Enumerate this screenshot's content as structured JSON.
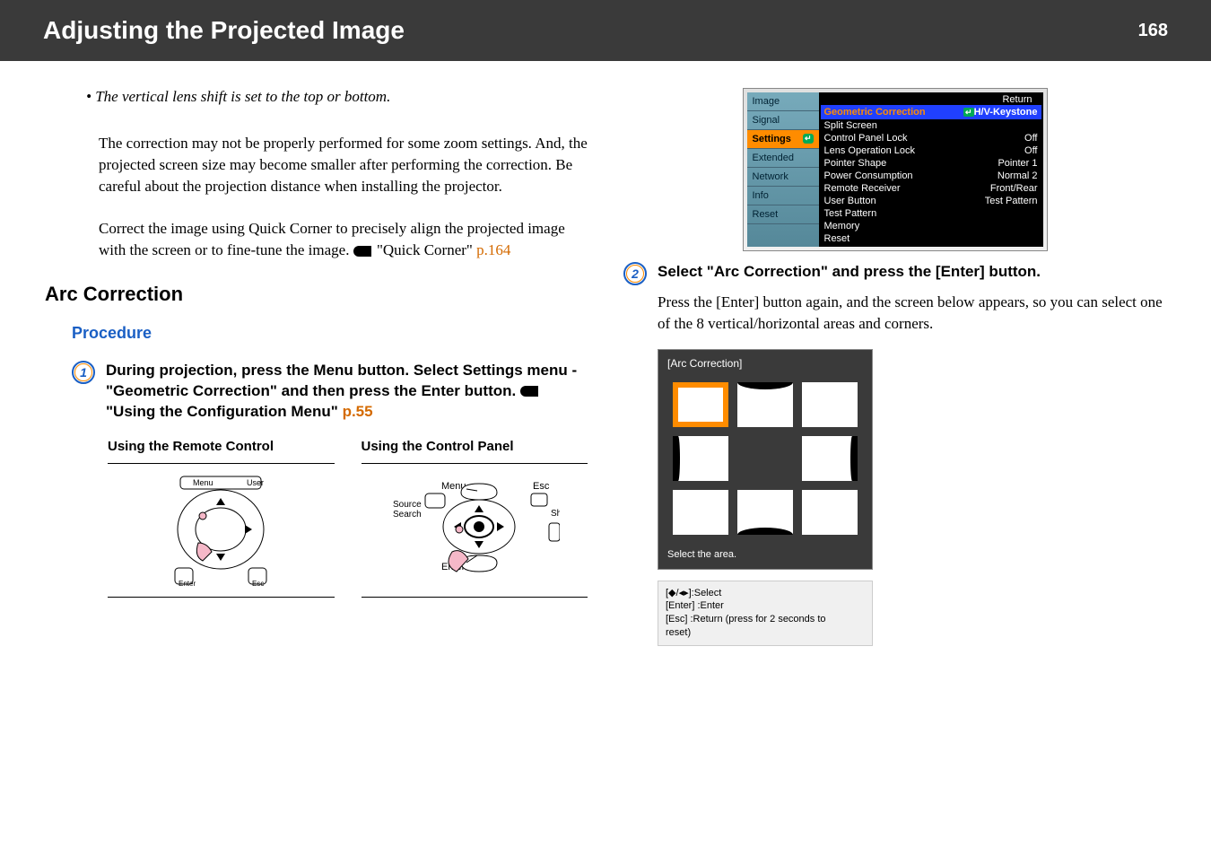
{
  "header": {
    "title": "Adjusting the Projected Image",
    "page": "168"
  },
  "left": {
    "bullet": "The vertical lens shift is set to the top or bottom.",
    "para1": "The correction may not be properly performed for some zoom settings. And, the projected screen size may become smaller after performing the correction. Be careful about the projection distance when installing the projector.",
    "para2_pre": "Correct the image using Quick Corner to precisely align the projected image with the screen or to fine-tune the image. ",
    "para2_link_label": "\"Quick Corner\"",
    "para2_link_page": "p.164",
    "section": "Arc Correction",
    "procedure": "Procedure",
    "step1_num": "1",
    "step1_a": "During projection, press the Menu button. Select Settings menu - \"Geometric Correction\" and then press the Enter button. ",
    "step1_b": "\"Using the Configuration Menu\"",
    "step1_c": "p.55",
    "remote_h": "Using the Remote Control",
    "panel_h": "Using the Control Panel",
    "remote_labels": {
      "menu": "Menu",
      "user": "User",
      "enter": "Enter",
      "esc": "Esc"
    },
    "panel_labels": {
      "menu": "Menu",
      "source": "Source\nSearch",
      "enter": "Enter",
      "esc": "Esc",
      "sh": "Sh"
    }
  },
  "right": {
    "osd": {
      "return": "Return",
      "tabs": [
        "Image",
        "Signal",
        "Settings",
        "Extended",
        "Network",
        "Info",
        "Reset"
      ],
      "selected_tab": "Settings",
      "rows": [
        {
          "k": "Geometric Correction",
          "v": "H/V-Keystone",
          "hl": true,
          "icon": true
        },
        {
          "k": "Split Screen",
          "v": ""
        },
        {
          "k": "Control Panel Lock",
          "v": "Off"
        },
        {
          "k": "Lens Operation Lock",
          "v": "Off"
        },
        {
          "k": "Pointer Shape",
          "v": "Pointer 1"
        },
        {
          "k": "Power Consumption",
          "v": "Normal 2"
        },
        {
          "k": "Remote Receiver",
          "v": "Front/Rear"
        },
        {
          "k": "User Button",
          "v": "Test Pattern"
        },
        {
          "k": "Test Pattern",
          "v": ""
        },
        {
          "k": "Memory",
          "v": ""
        },
        {
          "k": "Reset",
          "v": ""
        }
      ]
    },
    "step2_num": "2",
    "step2_head": "Select \"Arc Correction\" and press the [Enter] button.",
    "step2_body": "Press the [Enter] button again, and the screen below appears, so you can select one of the 8 vertical/horizontal areas and corners.",
    "arc": {
      "title": "[Arc Correction]",
      "foot": "Select the area.",
      "hints": "[◆/◂▸]:Select\n[Enter] :Enter\n[Esc] :Return (press for 2 seconds to\n           reset)"
    }
  }
}
